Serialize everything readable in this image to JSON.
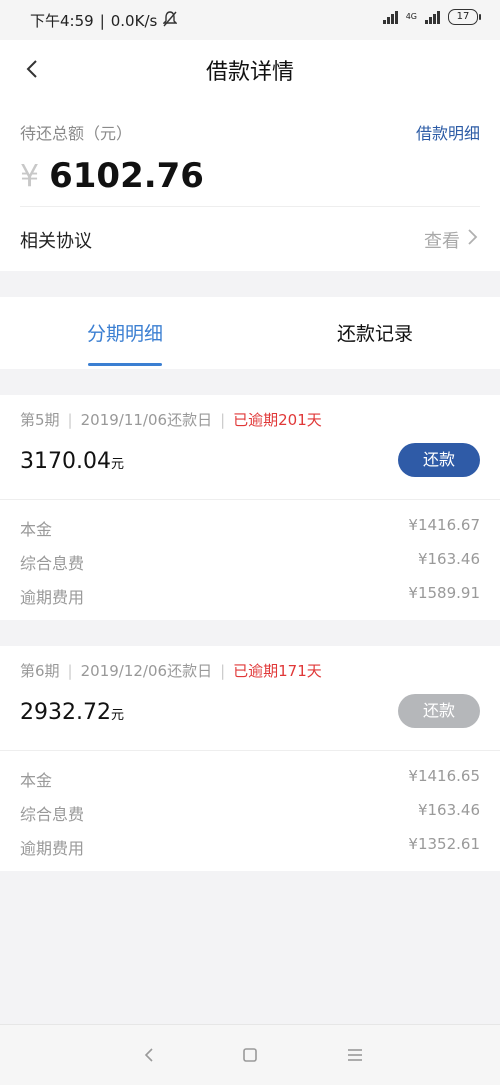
{
  "status_bar": {
    "time": "下午4:59",
    "speed": "0.0K/s",
    "network": "4G",
    "battery": "17"
  },
  "header": {
    "title": "借款详情"
  },
  "summary": {
    "label": "待还总额（元）",
    "detail_link": "借款明细",
    "currency": "¥",
    "amount": "6102.76",
    "agreement_label": "相关协议",
    "agreement_view": "查看"
  },
  "tabs": [
    {
      "label": "分期明细",
      "active": true
    },
    {
      "label": "还款记录",
      "active": false
    }
  ],
  "installments": [
    {
      "period": "第5期",
      "due": "2019/11/06还款日",
      "status": "已逾期201天",
      "amount": "3170.04",
      "unit": "元",
      "pay_label": "还款",
      "pay_enabled": true,
      "rows": [
        {
          "k": "本金",
          "v": "¥1416.67"
        },
        {
          "k": "综合息费",
          "v": "¥163.46"
        },
        {
          "k": "逾期费用",
          "v": "¥1589.91"
        }
      ]
    },
    {
      "period": "第6期",
      "due": "2019/12/06还款日",
      "status": "已逾期171天",
      "amount": "2932.72",
      "unit": "元",
      "pay_label": "还款",
      "pay_enabled": false,
      "rows": [
        {
          "k": "本金",
          "v": "¥1416.65"
        },
        {
          "k": "综合息费",
          "v": "¥163.46"
        },
        {
          "k": "逾期费用",
          "v": "¥1352.61"
        }
      ]
    }
  ],
  "colors": {
    "accent": "#3b7fd2",
    "pay_button": "#2f5ba7",
    "pay_button_disabled": "#b5b7ba",
    "overdue": "#e03838"
  }
}
